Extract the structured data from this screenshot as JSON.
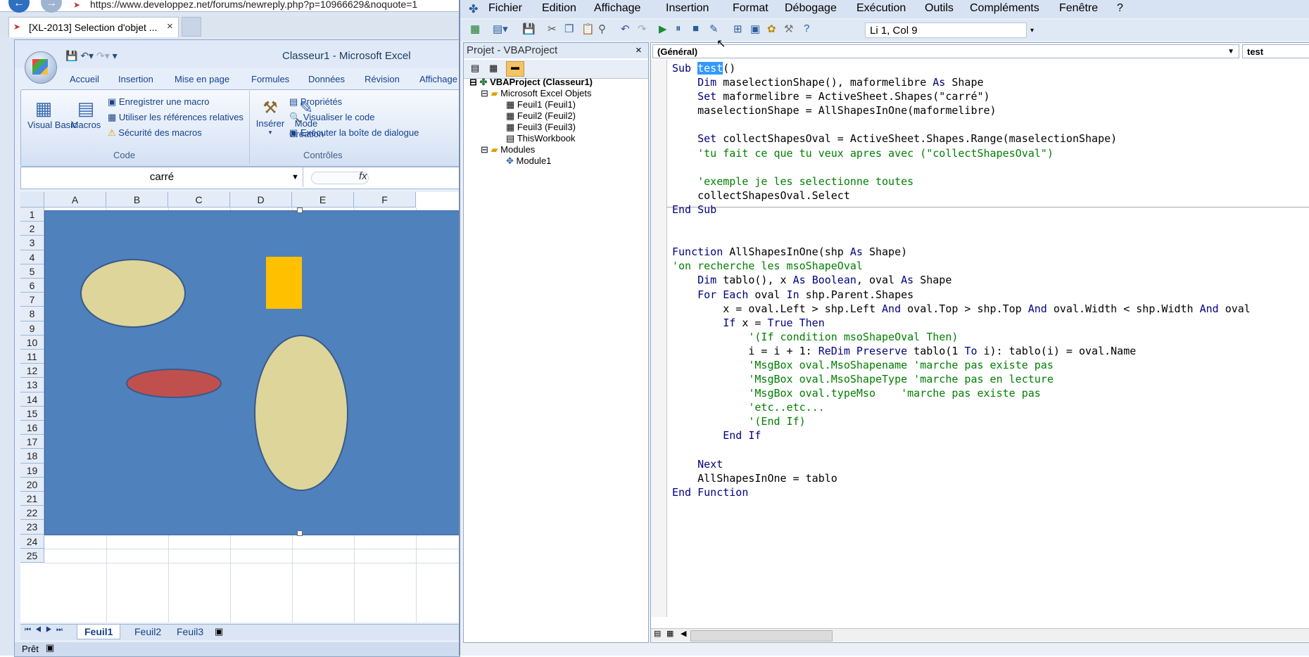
{
  "browser": {
    "url": "https://www.developpez.net/forums/newreply.php?p=10966629&noquote=1",
    "tab_title": "[XL-2013] Selection d'objet ...",
    "tab_close": "×"
  },
  "excel": {
    "window_title": "Classeur1 - Microsoft Excel",
    "ribbon_tabs": [
      "Accueil",
      "Insertion",
      "Mise en page",
      "Formules",
      "Données",
      "Révision",
      "Affichage"
    ],
    "group_code": {
      "label": "Code",
      "visual_basic": "Visual Basic",
      "macros": "Macros",
      "record_macro": "Enregistrer une macro",
      "relative_refs": "Utiliser les références relatives",
      "macro_security": "Sécurité des macros"
    },
    "group_controls": {
      "label": "Contrôles",
      "insert": "Insérer",
      "design_mode_1": "Mode",
      "design_mode_2": "Création",
      "properties": "Propriétés",
      "view_code": "Visualiser le code",
      "run_dialog": "Exécuter la boîte de dialogue"
    },
    "name_box": "carré",
    "fx_label": "fx",
    "columns": [
      "A",
      "B",
      "C",
      "D",
      "E",
      "F"
    ],
    "rows": [
      "1",
      "2",
      "3",
      "4",
      "5",
      "6",
      "7",
      "8",
      "9",
      "10",
      "11",
      "12",
      "13",
      "14",
      "15",
      "16",
      "17",
      "18",
      "19",
      "20",
      "21",
      "22",
      "23",
      "24",
      "25"
    ],
    "sheets": [
      "Feuil1",
      "Feuil2",
      "Feuil3"
    ],
    "status": "Prêt",
    "colors": {
      "rectangle": "#4f81bd",
      "ellipse": "#ddd59a",
      "red_ellipse": "#c0504d",
      "small_rect": "#ffc000"
    }
  },
  "vbe": {
    "menus": [
      "Fichier",
      "Edition",
      "Affichage",
      "Insertion",
      "Format",
      "Débogage",
      "Exécution",
      "Outils",
      "Compléments",
      "Fenêtre",
      "?"
    ],
    "cursor_position": "Li 1, Col 9",
    "project_title": "Projet - VBAProject",
    "project_close": "×",
    "tree": {
      "root": "VBAProject (Classeur1)",
      "excel_objects": "Microsoft Excel Objets",
      "sheets": [
        "Feuil1 (Feuil1)",
        "Feuil2 (Feuil2)",
        "Feuil3 (Feuil3)",
        "ThisWorkbook"
      ],
      "modules_folder": "Modules",
      "modules": [
        "Module1"
      ]
    },
    "object_combo": "(Général)",
    "proc_combo": "test",
    "code_lines": [
      "Sub test()",
      "    Dim maselectionShape(), maformelibre As Shape",
      "    Set maformelibre = ActiveSheet.Shapes(\"carré\")",
      "    maselectionShape = AllShapesInOne(maformelibre)",
      "",
      "    Set collectShapesOval = ActiveSheet.Shapes.Range(maselectionShape)",
      "    'tu fait ce que tu veux apres avec (\"collectShapesOval\")",
      "",
      "    'exemple je les selectionne toutes",
      "    collectShapesOval.Select",
      "End Sub",
      "",
      "",
      "Function AllShapesInOne(shp As Shape)",
      "'on recherche les msoShapeOval",
      "    Dim tablo(), x As Boolean, oval As Shape",
      "    For Each oval In shp.Parent.Shapes",
      "        x = oval.Left > shp.Left And oval.Top > shp.Top And oval.Width < shp.Width And oval",
      "        If x = True Then",
      "            '(If condition msoShapeOval Then)",
      "            i = i + 1: ReDim Preserve tablo(1 To i): tablo(i) = oval.Name",
      "            'MsgBox oval.MsoShapename 'marche pas existe pas",
      "            'MsgBox oval.MsoShapeType 'marche pas en lecture",
      "            'MsgBox oval.typeMso    'marche pas existe pas",
      "            'etc..etc...",
      "            '(End If)",
      "        End If",
      "",
      "    Next",
      "    AllShapesInOne = tablo",
      "End Function"
    ]
  }
}
